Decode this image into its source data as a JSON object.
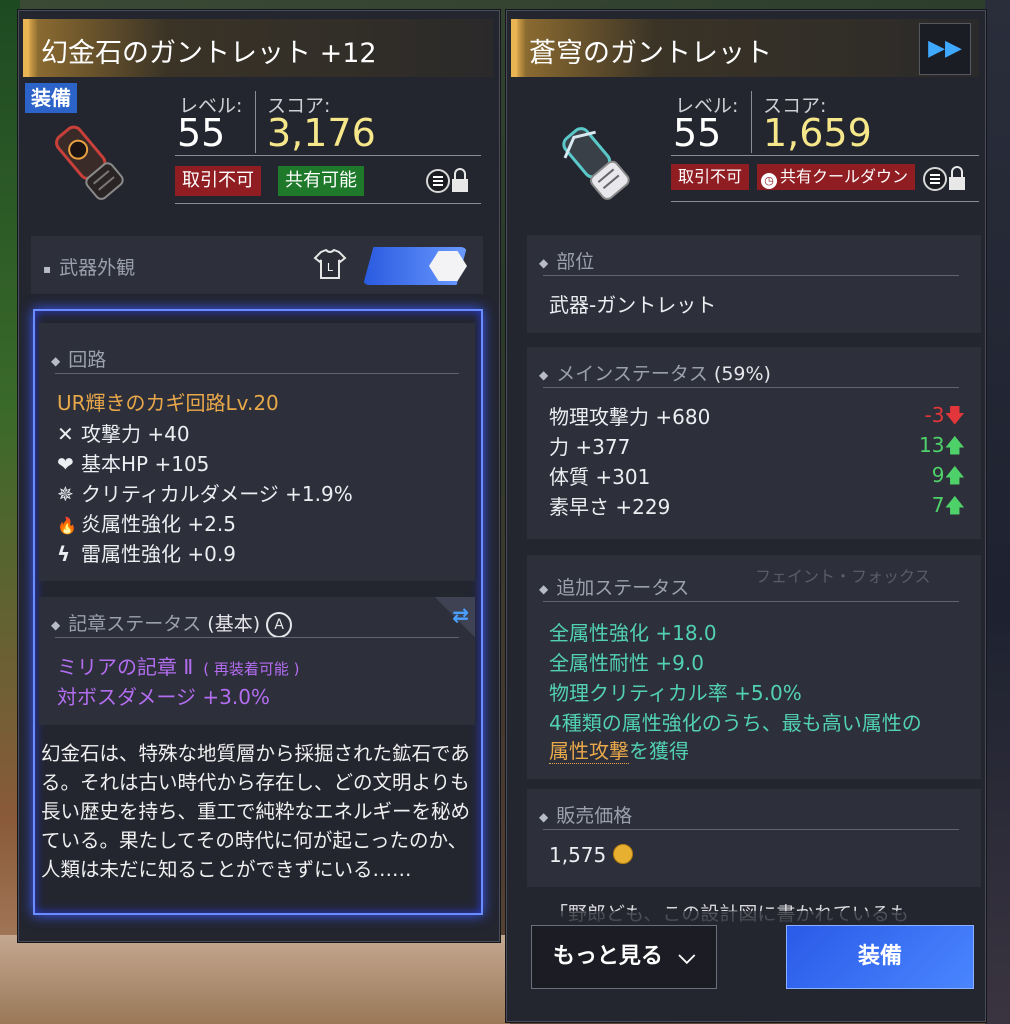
{
  "left_panel": {
    "title": "幻金石のガントレット +12",
    "equipped_tag": "装備",
    "level_label": "レベル:",
    "level_value": "55",
    "score_label": "スコア:",
    "score_value": "3,176",
    "badge_trade": "取引不可",
    "badge_share": "共有可能",
    "appearance_label": "武器外観",
    "appearance_icon_letter": "L",
    "circuit": {
      "header": "回路",
      "name": "UR輝きのカギ回路Lv.20",
      "stats": [
        {
          "icon": "attack-icon",
          "glyph": "✕",
          "text": "攻撃力 +40"
        },
        {
          "icon": "heart-plus-icon",
          "glyph": "❤",
          "text": "基本HP +105"
        },
        {
          "icon": "critical-icon",
          "glyph": "✵",
          "text": "クリティカルダメージ +1.9%"
        },
        {
          "icon": "fire-icon",
          "glyph": "🔥",
          "text": "炎属性強化 +2.5"
        },
        {
          "icon": "lightning-icon",
          "glyph": "ϟ",
          "text": "雷属性強化 +0.9"
        }
      ]
    },
    "emblem": {
      "header": "記章ステータス",
      "header_suffix": "(基本)",
      "circle_letter": "A",
      "name": "ミリアの記章 Ⅱ",
      "note": "( 再装着可能 )",
      "stat": "対ボスダメージ +3.0%"
    },
    "description": "幻金石は、特殊な地質層から採掘された鉱石である。それは古い時代から存在し、どの文明よりも長い歴史を持ち、重工で純粋なエネルギーを秘めている。果たしてその時代に何が起こったのか、人類は未だに知ることができずにいる……"
  },
  "right_panel": {
    "title": "蒼穹のガントレット",
    "level_label": "レベル:",
    "level_value": "55",
    "score_label": "スコア:",
    "score_value": "1,659",
    "badge_trade": "取引不可",
    "badge_share": "共有クールダウン",
    "part": {
      "header": "部位",
      "value": "武器-ガントレット"
    },
    "main_status": {
      "header": "メインステータス",
      "percent": "(59%)",
      "rows": [
        {
          "label": "物理攻撃力 +680",
          "diff": "-3",
          "dir": "down"
        },
        {
          "label": "力 +377",
          "diff": "13",
          "dir": "up"
        },
        {
          "label": "体質 +301",
          "diff": "9",
          "dir": "up"
        },
        {
          "label": "素早さ +229",
          "diff": "7",
          "dir": "up"
        }
      ]
    },
    "extra_status": {
      "header": "追加ステータス",
      "rows": [
        "全属性強化 +18.0",
        "全属性耐性 +9.0",
        "物理クリティカル率 +5.0%",
        "4種類の属性強化のうち、最も高い属性の"
      ],
      "last_link": "属性攻撃",
      "last_suffix": "を獲得",
      "bg_text": "フェイント・フォックス"
    },
    "sell_price": {
      "header": "販売価格",
      "value": "1,575"
    },
    "quote_preview": "「野郎ども、この設計図に書かれているも",
    "more_button": "もっと見る",
    "equip_button": "装備"
  },
  "colors": {
    "score": "#f6e88a",
    "orange": "#e9a84a",
    "purple": "#b36df0",
    "teal": "#52d1b2",
    "red_badge": "#8f1d22",
    "green_badge": "#1e7a2a",
    "equip_blue": "#2b63c9"
  }
}
